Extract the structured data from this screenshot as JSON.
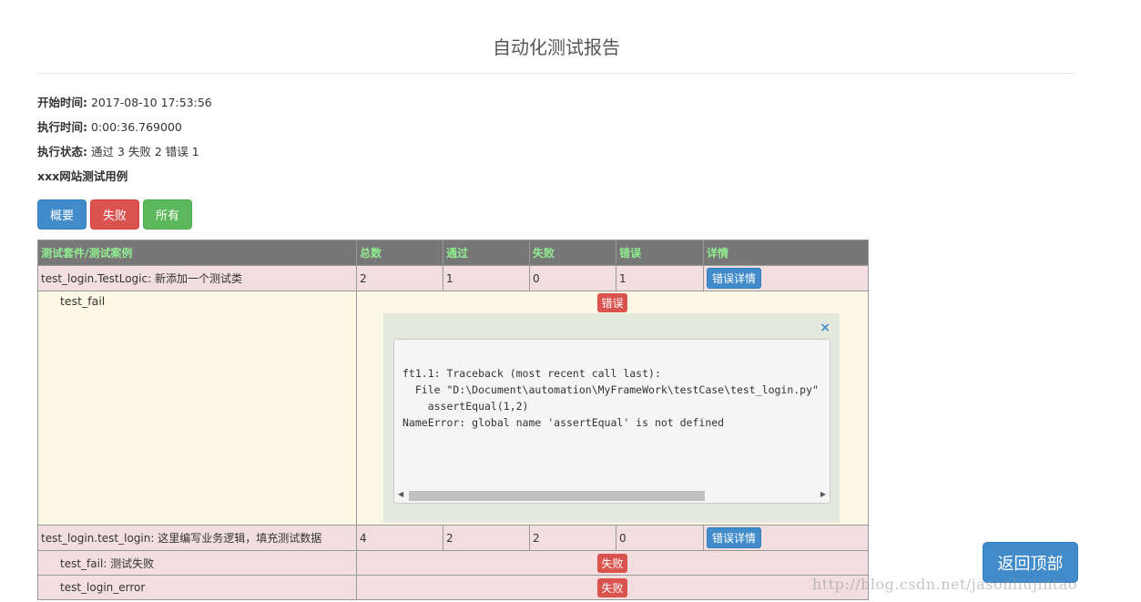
{
  "page": {
    "title": "自动化测试报告"
  },
  "meta": {
    "start_label": "开始时间:",
    "start_value": "2017-08-10 17:53:56",
    "duration_label": "执行时间:",
    "duration_value": "0:00:36.769000",
    "status_label": "执行状态:",
    "status_value": "通过 3 失败 2 错误 1",
    "description": "xxx网站测试用例"
  },
  "filters": {
    "summary": "概要",
    "failed": "失败",
    "all": "所有"
  },
  "table": {
    "headers": [
      "测试套件/测试案例",
      "总数",
      "通过",
      "失败",
      "错误",
      "详情"
    ],
    "suite1": {
      "name": "test_login.TestLogic: 新添加一个测试类",
      "total": "2",
      "pass": "1",
      "fail": "0",
      "error": "1",
      "detail": "错误详情"
    },
    "case1": {
      "name": "test_fail",
      "status": "错误"
    },
    "suite2": {
      "name": "test_login.test_login: 这里编写业务逻辑，填充测试数据",
      "total": "4",
      "pass": "2",
      "fail": "2",
      "error": "0",
      "detail": "错误详情"
    },
    "case2": {
      "name": "test_fail: 测试失败",
      "status": "失败"
    },
    "case3": {
      "name": "test_login_error",
      "status": "失败"
    }
  },
  "error_popup": {
    "close": "×",
    "traceback": "ft1.1: Traceback (most recent call last):\n  File \"D:\\Document\\automation\\MyFrameWork\\testCase\\test_login.py\"\n    assertEqual(1,2)\nNameError: global name 'assertEqual' is not defined"
  },
  "back_to_top": "返回顶部",
  "watermark": "http://blog.csdn.net/jasonliujintao"
}
